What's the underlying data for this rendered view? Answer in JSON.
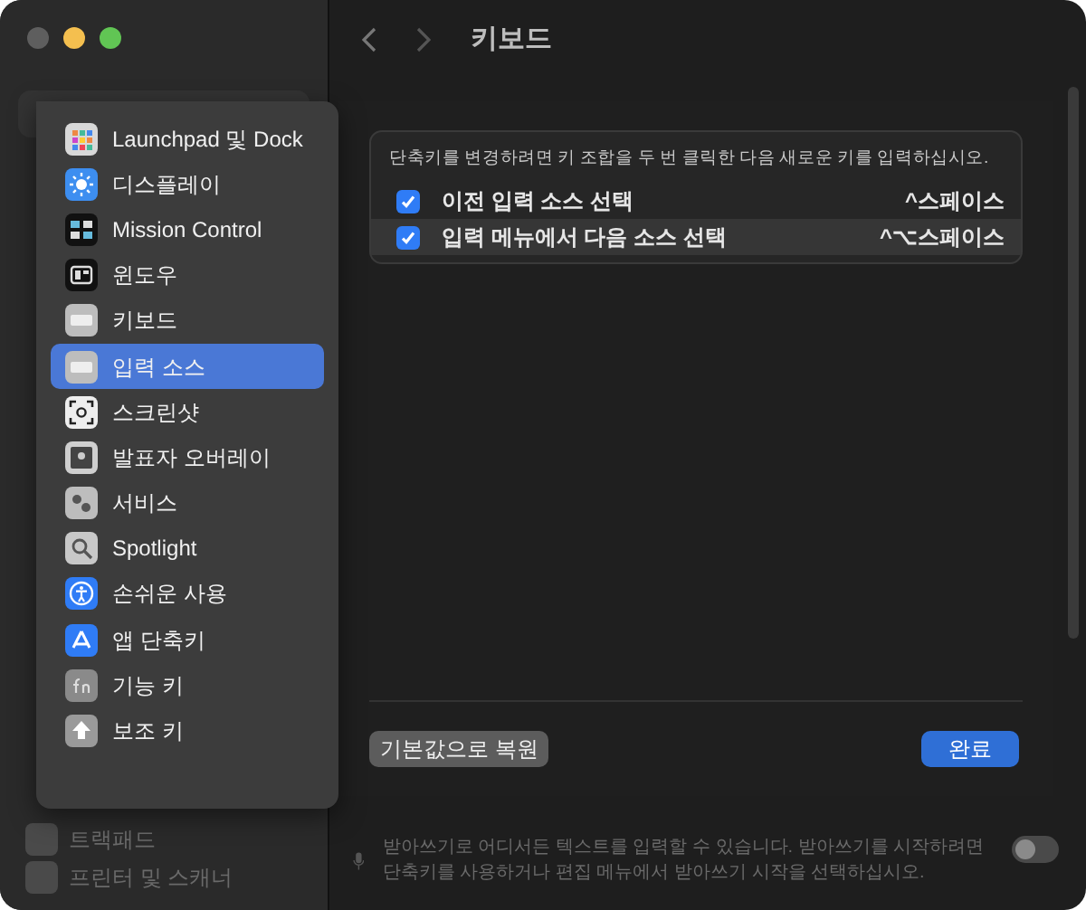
{
  "toolbar": {
    "title": "키보드"
  },
  "sidebar": {
    "items": [
      {
        "label": "트랙패드"
      },
      {
        "label": "프린터 및 스캐너"
      }
    ]
  },
  "menu": {
    "items": [
      {
        "label": "Launchpad 및 Dock",
        "selected": false
      },
      {
        "label": "디스플레이",
        "selected": false
      },
      {
        "label": "Mission Control",
        "selected": false
      },
      {
        "label": "윈도우",
        "selected": false
      },
      {
        "label": "키보드",
        "selected": false
      },
      {
        "label": "입력 소스",
        "selected": true
      },
      {
        "label": "스크린샷",
        "selected": false
      },
      {
        "label": "발표자 오버레이",
        "selected": false
      },
      {
        "label": "서비스",
        "selected": false
      },
      {
        "label": "Spotlight",
        "selected": false
      },
      {
        "label": "손쉬운 사용",
        "selected": false
      },
      {
        "label": "앱 단축키",
        "selected": false
      },
      {
        "label": "기능 키",
        "selected": false
      },
      {
        "label": "보조 키",
        "selected": false
      }
    ]
  },
  "shortcuts": {
    "hint": "단축키를 변경하려면 키 조합을 두 번 클릭한 다음 새로운 키를 입력하십시오.",
    "rows": [
      {
        "label": "이전 입력 소스 선택",
        "checked": true,
        "keys": "^스페이스",
        "selected": false
      },
      {
        "label": "입력 메뉴에서 다음 소스 선택",
        "checked": true,
        "keys": "^⌥스페이스",
        "selected": true
      }
    ]
  },
  "buttons": {
    "restore": "기본값으로 복원",
    "done": "완료"
  },
  "dictation": {
    "description": "받아쓰기로 어디서든 텍스트를 입력할 수 있습니다. 받아쓰기를 시작하려면 단축키를 사용하거나 편집 메뉴에서 받아쓰기 시작을 선택하십시오.",
    "on": false
  }
}
